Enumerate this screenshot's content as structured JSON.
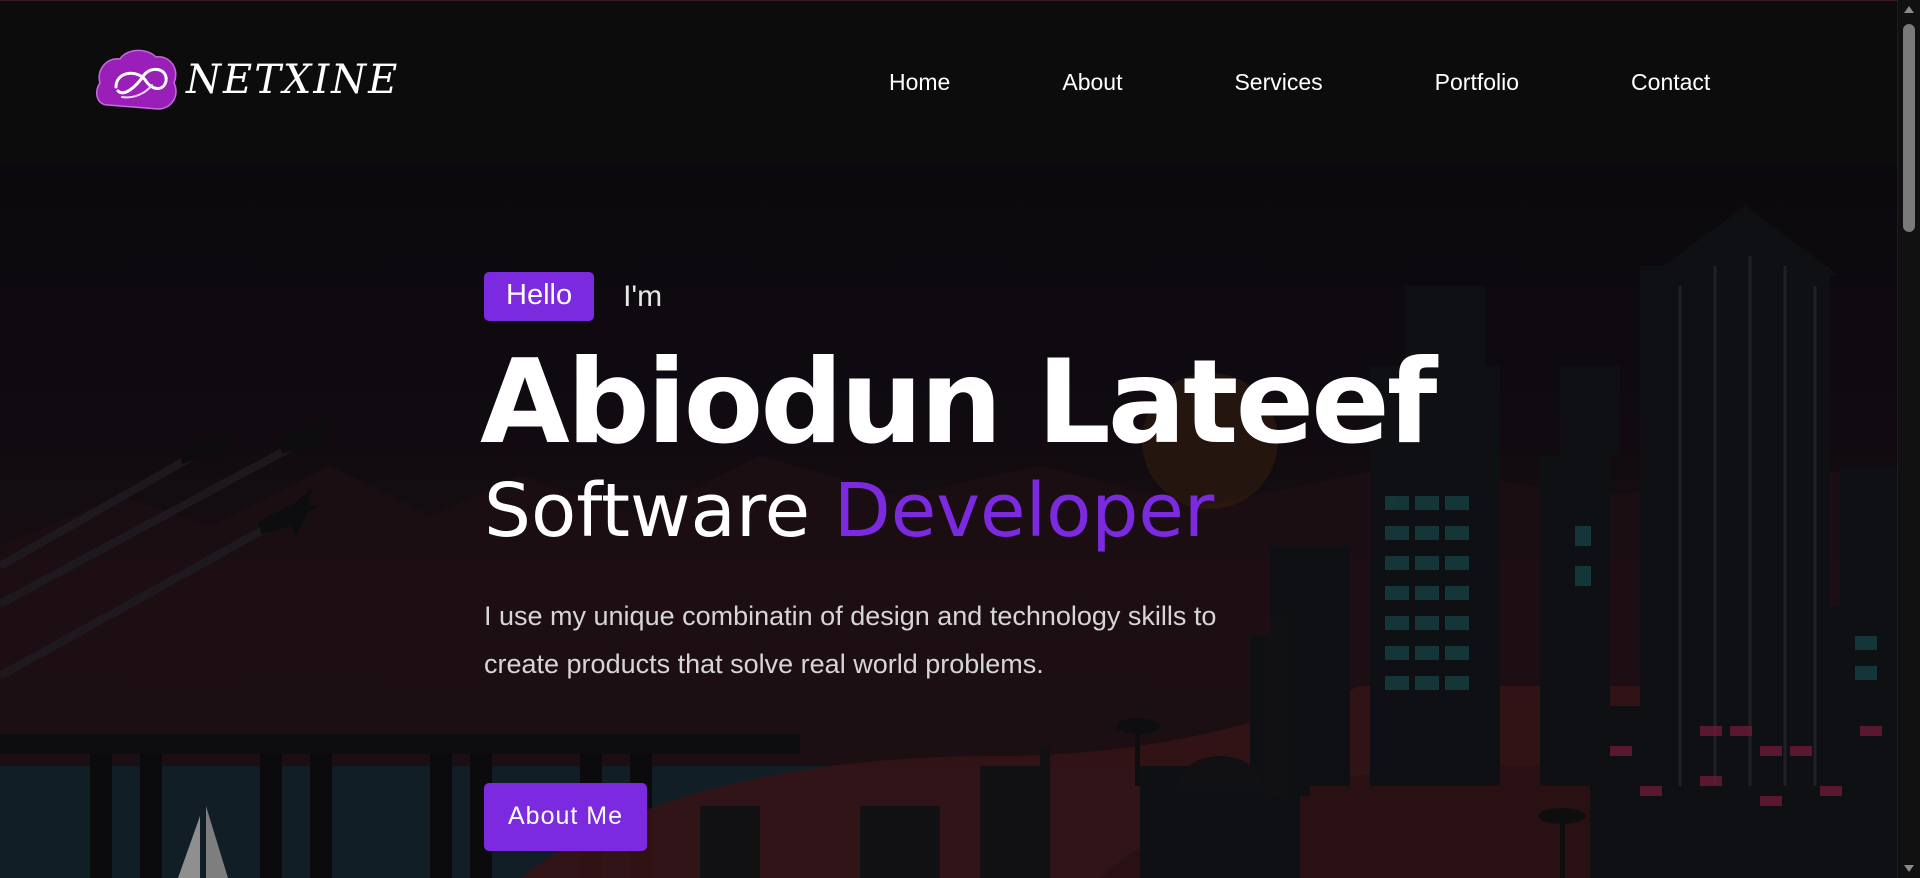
{
  "header": {
    "logo_text": "NETXINE",
    "nav": [
      {
        "label": "Home"
      },
      {
        "label": "About"
      },
      {
        "label": "Services"
      },
      {
        "label": "Portfolio"
      },
      {
        "label": "Contact"
      }
    ]
  },
  "hero": {
    "hello_badge": "Hello",
    "im_text": "I'm",
    "name": "Abiodun Lateef",
    "title_prefix": "Software",
    "title_accent": "Developer",
    "description": "I use my unique combinatin of design and technology skills to create products that solve real world problems.",
    "cta_label": "About Me"
  },
  "theme": {
    "accent": "#7c2ae0",
    "header_bg": "#0c0c0c",
    "text": "#ffffff"
  }
}
